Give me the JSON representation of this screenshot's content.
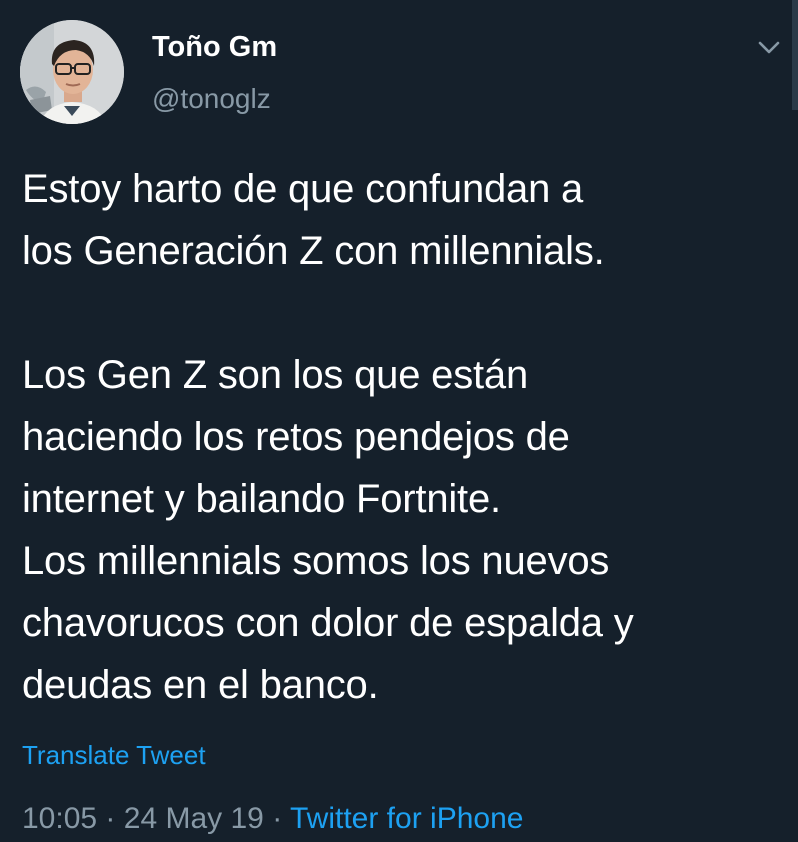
{
  "author": {
    "display_name": "Toño Gm",
    "handle": "@tonoglz"
  },
  "tweet": {
    "text": "Estoy harto de que confundan a\nlos Generación Z con millennials.\n\nLos Gen Z son los que están\nhaciendo los retos pendejos de\ninternet y bailando Fortnite.\nLos millennials somos los nuevos\nchavorucos con dolor de espalda y\ndeudas en el banco.",
    "translate_label": "Translate Tweet"
  },
  "meta": {
    "time": "10:05",
    "separator": "·",
    "date": "24 May 19",
    "source": "Twitter for iPhone"
  },
  "icons": {
    "menu": "chevron-down-icon"
  },
  "colors": {
    "background": "#15202b",
    "text": "#ffffff",
    "muted": "#8899a6",
    "accent": "#1da1f2"
  }
}
